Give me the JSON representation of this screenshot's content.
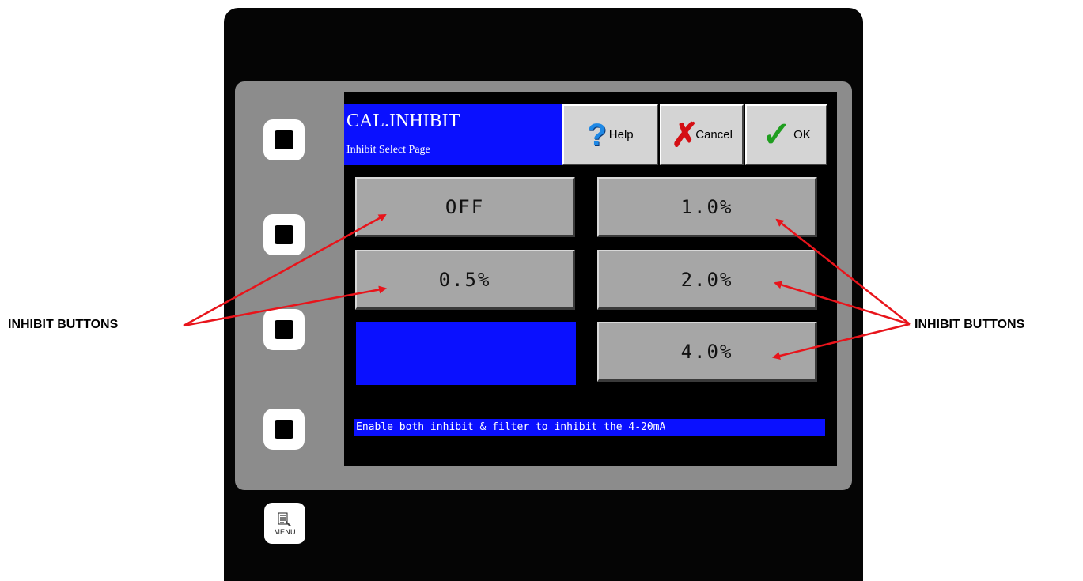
{
  "header": {
    "title": "CAL.INHIBIT",
    "subtitle": "Inhibit Select Page"
  },
  "toolbar": {
    "help_label": "Help",
    "cancel_label": "Cancel",
    "ok_label": "OK"
  },
  "inhibit_options": {
    "off": "OFF",
    "half": "0.5%",
    "one": "1.0%",
    "two": "2.0%",
    "four": "4.0%"
  },
  "status_text": "Enable both inhibit & filter to inhibit the 4-20mA",
  "menu_label": "MENU",
  "callouts": {
    "left": "INHIBIT BUTTONS",
    "right": "INHIBIT BUTTONS"
  },
  "colors": {
    "screen_blue": "#0a10ff",
    "button_gray": "#a6a6a6",
    "arrow_red": "#e8141b"
  },
  "icons": {
    "help": "question-icon",
    "cancel": "red-x-icon",
    "ok": "green-check-icon",
    "menu": "menu-icon"
  }
}
